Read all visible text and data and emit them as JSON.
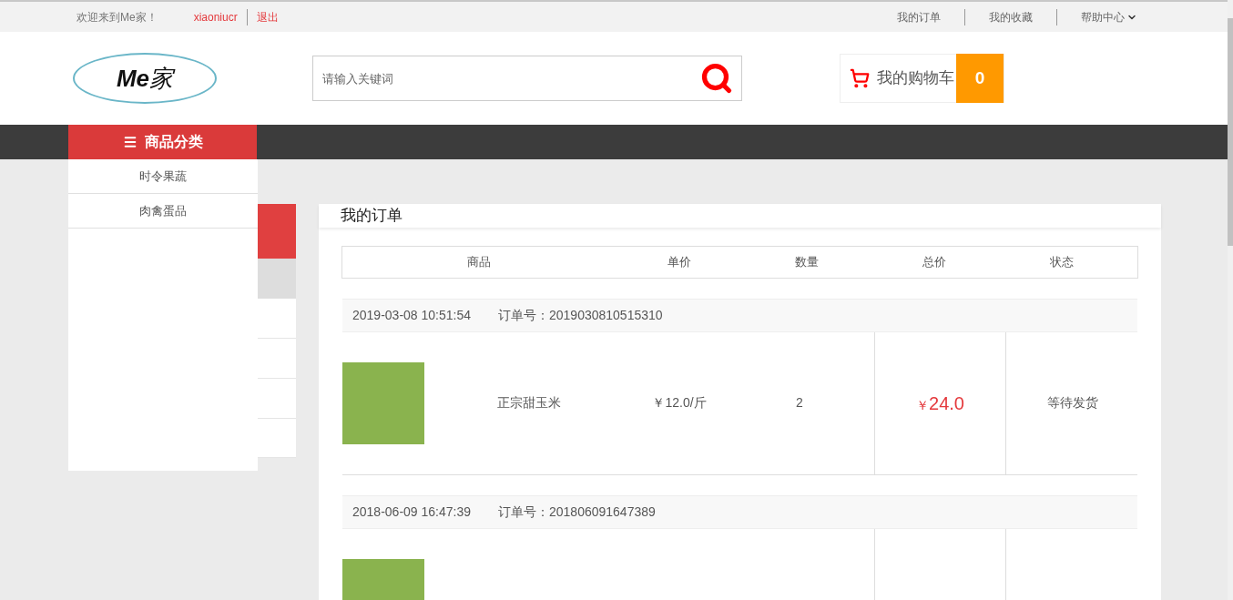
{
  "top_bar": {
    "welcome": "欢迎来到Me家！",
    "username": "xiaoniucr",
    "logout": "退出",
    "links": [
      {
        "label": "我的订单",
        "dropdown": false
      },
      {
        "label": "我的收藏",
        "dropdown": false
      },
      {
        "label": "帮助中心",
        "dropdown": true
      }
    ]
  },
  "header": {
    "logo": {
      "latin": "Me",
      "cjk": "家"
    },
    "search": {
      "placeholder": "请输入关键词"
    },
    "cart": {
      "label": "我的购物车",
      "count": "0"
    }
  },
  "nav": {
    "category_button": "商品分类"
  },
  "category_menu": {
    "items": [
      "时令果蔬",
      "肉禽蛋品"
    ]
  },
  "orders_panel": {
    "title": "我的订单",
    "columns": [
      "商品",
      "单价",
      "数量",
      "总价",
      "状态"
    ],
    "orders": [
      {
        "date": "2019-03-08 10:51:54",
        "order_no": "订单号：2019030810515310",
        "items": [
          {
            "photo": true,
            "name": "正宗甜玉米",
            "unit_price": "￥12.0/斤",
            "quantity": "2",
            "currency": "￥",
            "total": "24.0",
            "status": "等待发货"
          }
        ]
      },
      {
        "date": "2018-06-09 16:47:39",
        "order_no": "订单号：201806091647389",
        "items": [
          {
            "photo": true
          }
        ]
      }
    ]
  }
}
